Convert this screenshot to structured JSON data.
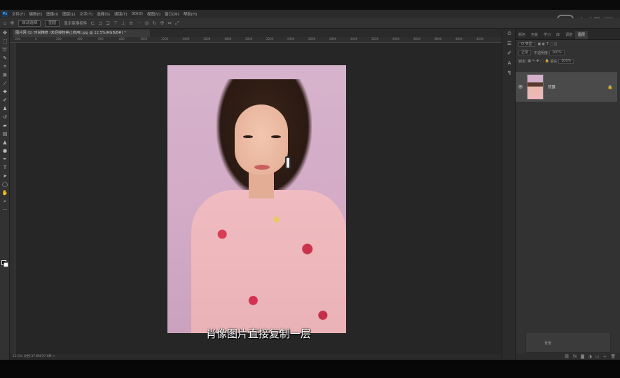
{
  "menubar": {
    "app_icon": "Ps",
    "items": [
      "文件(F)",
      "编辑(E)",
      "图像(I)",
      "图层(L)",
      "文字(Y)",
      "选择(S)",
      "滤镜(T)",
      "3D(D)",
      "视图(V)",
      "窗口(W)",
      "帮助(H)"
    ]
  },
  "brand": {
    "text": "虎课网"
  },
  "options_bar": {
    "auto_select_label": "自动选择",
    "auto_select_target": "图层",
    "transform_controls_label": "显示变换控件",
    "more_label": "···"
  },
  "document": {
    "tab_title": "图片网 (1) 时尚精修 (未经授权禁止商用).jpg @ 12.5%(RGB/8#) *",
    "ruler_ticks": [
      "-200",
      "0",
      "200",
      "400",
      "600",
      "800",
      "1000",
      "1200",
      "1400",
      "1600",
      "1800",
      "2000",
      "2200",
      "2400",
      "2600",
      "2800",
      "3000",
      "3200",
      "3400",
      "3600",
      "3800",
      "4000",
      "4200"
    ],
    "status_text": "12.5%    文档:37.6M/37.6M    >",
    "caption": "肖像图片直接复制一层"
  },
  "panel": {
    "tabs": [
      "颜色",
      "色板",
      "学习",
      "库",
      "调整",
      "图层"
    ],
    "active_tab": "图层",
    "kind_filter": "Q 类型",
    "blend_mode": "正常",
    "opacity_label": "不透明度:",
    "opacity_value": "100%",
    "lock_label": "锁定:",
    "fill_label": "填充:",
    "fill_value": "100%",
    "layers": [
      {
        "name": "背景",
        "locked": true
      }
    ],
    "copy_layer_label": "背景"
  },
  "colors": {
    "canvas_bg": "#262626",
    "panel_bg": "#323232",
    "selected_layer": "#4a4a4a"
  }
}
